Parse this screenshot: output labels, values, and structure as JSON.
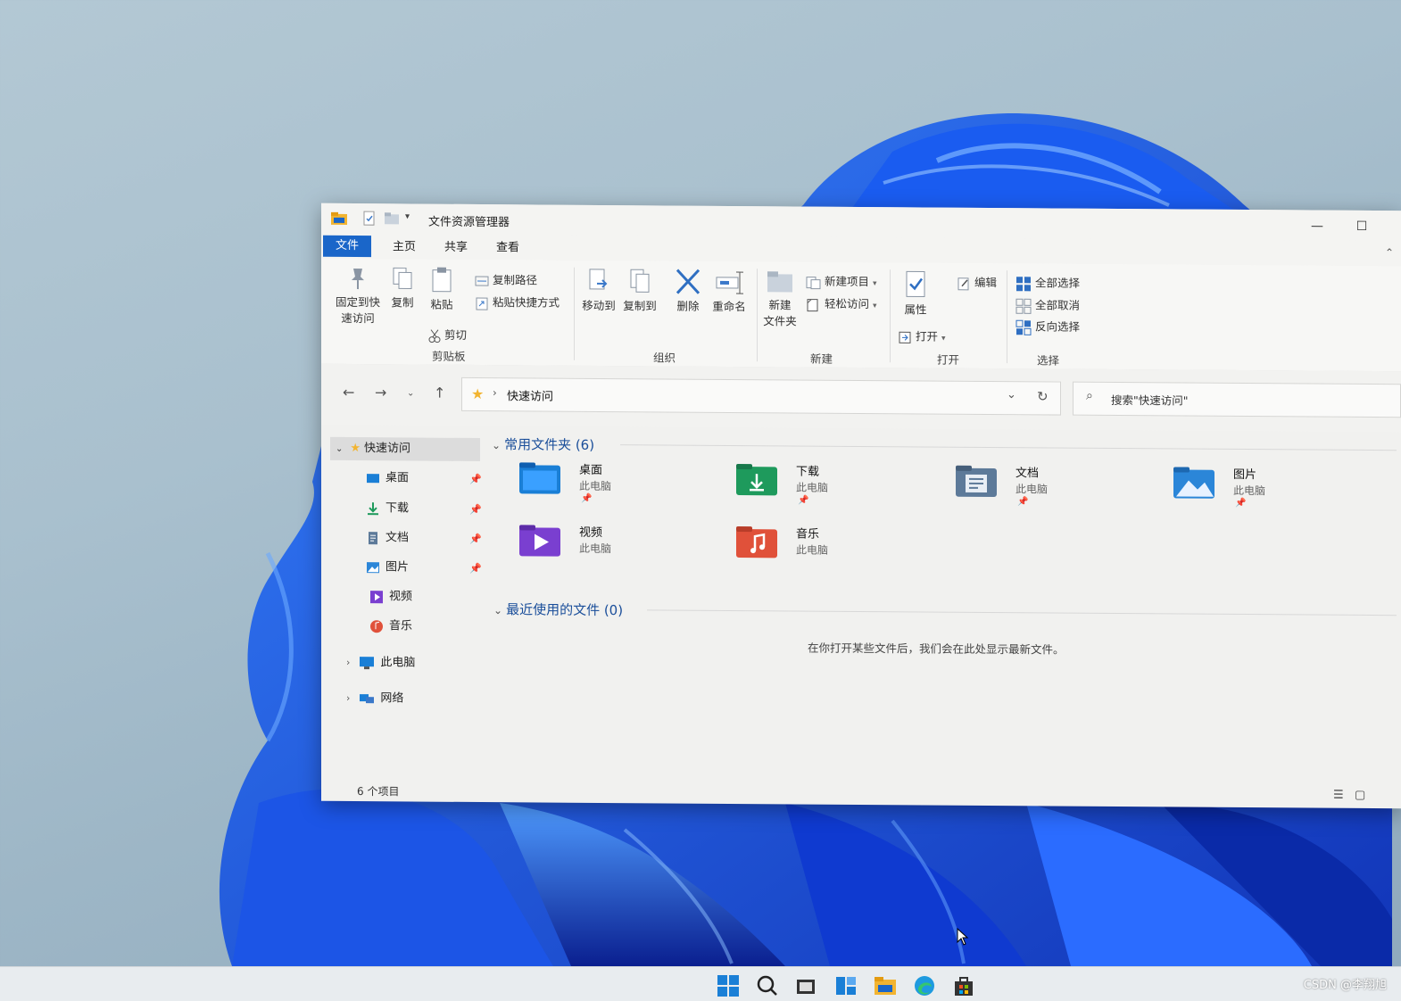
{
  "window": {
    "title": "文件资源管理器",
    "minimize_label": "—",
    "maximize_label": "☐"
  },
  "tabs": [
    "文件",
    "主页",
    "共享",
    "查看"
  ],
  "ribbon": {
    "clipboard": {
      "pin_label_1": "固定到快",
      "pin_label_2": "速访问",
      "copy_label": "复制",
      "paste_label": "粘贴",
      "copy_path_label": "复制路径",
      "paste_shortcut_label": "粘贴快捷方式",
      "cut_label": "剪切",
      "group_label": "剪贴板"
    },
    "organize": {
      "move_to_label": "移动到",
      "copy_to_label": "复制到",
      "delete_label": "删除",
      "rename_label": "重命名",
      "group_label": "组织"
    },
    "new": {
      "new_folder_label_1": "新建",
      "new_folder_label_2": "文件夹",
      "new_item_label": "新建项目",
      "easy_access_label": "轻松访问",
      "group_label": "新建"
    },
    "open": {
      "properties_label": "属性",
      "edit_label": "编辑",
      "open_label": "打开",
      "group_label": "打开"
    },
    "select": {
      "select_all_label": "全部选择",
      "select_none_label": "全部取消",
      "invert_label": "反向选择",
      "group_label": "选择"
    }
  },
  "navigation": {
    "address_path": "快速访问",
    "search_placeholder": "搜索\"快速访问\""
  },
  "sidebar": {
    "quick_access": "快速访问",
    "items": [
      "桌面",
      "下载",
      "文档",
      "图片",
      "视频",
      "音乐"
    ],
    "this_pc": "此电脑",
    "network": "网络"
  },
  "content": {
    "frequent_header": "常用文件夹 (6)",
    "recent_header": "最近使用的文件 (0)",
    "empty_message": "在你打开某些文件后，我们会在此处显示最新文件。",
    "folders": [
      {
        "name": "桌面",
        "location": "此电脑",
        "icon": "desktop-folder-icon",
        "color": "#1a7fd6"
      },
      {
        "name": "下载",
        "location": "此电脑",
        "icon": "downloads-folder-icon",
        "color": "#1e9a5c"
      },
      {
        "name": "文档",
        "location": "此电脑",
        "icon": "documents-folder-icon",
        "color": "#5d7a99"
      },
      {
        "name": "图片",
        "location": "此电脑",
        "icon": "pictures-folder-icon",
        "color": "#2b86d8"
      },
      {
        "name": "视频",
        "location": "此电脑",
        "icon": "videos-folder-icon",
        "color": "#7a3fd0"
      },
      {
        "name": "音乐",
        "location": "此电脑",
        "icon": "music-folder-icon",
        "color": "#e0513a"
      }
    ]
  },
  "status": {
    "item_count": "6 个项目"
  },
  "watermark": "CSDN @李翔旭"
}
